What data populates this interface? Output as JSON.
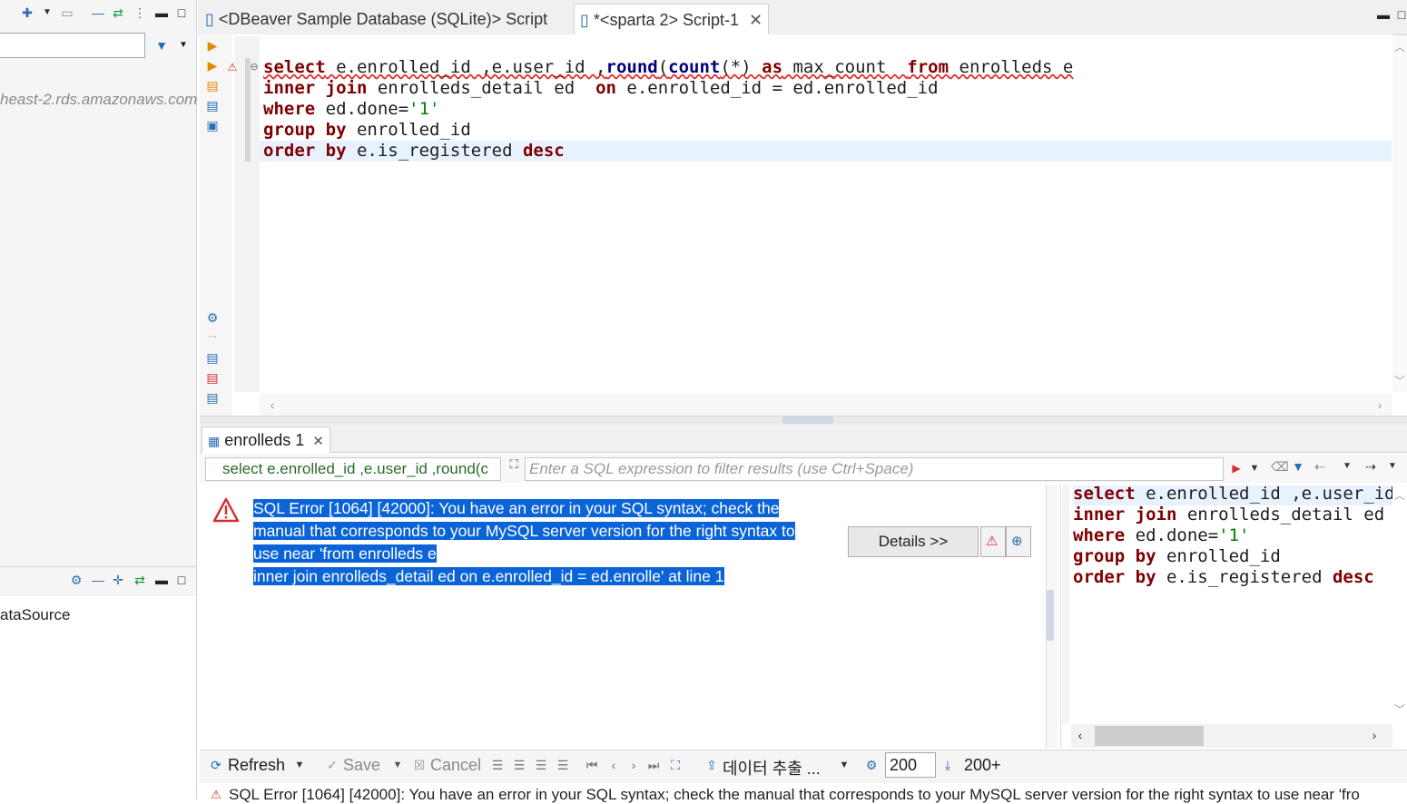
{
  "editor_tabs": [
    {
      "label": "<DBeaver Sample Database (SQLite)> Script"
    },
    {
      "label": "*<sparta 2> Script-1"
    }
  ],
  "navigator": {
    "connection_url": "heast-2.rds.amazonaws.com",
    "datasource_label": "ataSource"
  },
  "sql": {
    "lines": [
      {
        "tokens": [
          {
            "t": "select",
            "c": "kw"
          },
          {
            "t": " e.enrolled_id ,e.user_id ,",
            "c": ""
          },
          {
            "t": "round",
            "c": "kw2"
          },
          {
            "t": "(",
            "c": ""
          },
          {
            "t": "count",
            "c": "kw2"
          },
          {
            "t": "(*) ",
            "c": ""
          },
          {
            "t": "as",
            "c": "kw"
          },
          {
            "t": " max_count  ",
            "c": ""
          },
          {
            "t": "from",
            "c": "kw"
          },
          {
            "t": " enrolleds e",
            "c": ""
          }
        ]
      },
      {
        "tokens": [
          {
            "t": "inner join",
            "c": "kw"
          },
          {
            "t": " enrolleds_detail ed  ",
            "c": ""
          },
          {
            "t": "on",
            "c": "kw"
          },
          {
            "t": " e.enrolled_id = ed.enrolled_id",
            "c": ""
          }
        ]
      },
      {
        "tokens": [
          {
            "t": "where",
            "c": "kw"
          },
          {
            "t": " ed.done=",
            "c": ""
          },
          {
            "t": "'1'",
            "c": "str"
          }
        ]
      },
      {
        "tokens": [
          {
            "t": "group by",
            "c": "kw"
          },
          {
            "t": " enrolled_id",
            "c": ""
          }
        ]
      },
      {
        "tokens": [
          {
            "t": "order by",
            "c": "kw"
          },
          {
            "t": " e.is_registered ",
            "c": ""
          },
          {
            "t": "desc",
            "c": "kw"
          }
        ]
      }
    ]
  },
  "results": {
    "tab_label": "enrolleds 1",
    "query_snippet": "select e.enrolled_id ,e.user_id ,round(c",
    "filter_placeholder": "Enter a SQL expression to filter results (use Ctrl+Space)",
    "error_lines": [
      "SQL Error [1064] [42000]: You have an error in your SQL syntax; check the",
      "manual that corresponds to your MySQL server version for the right syntax to",
      "use near 'from enrolleds e",
      "inner join enrolleds_detail ed  on e.enrolled_id = ed.enrolle' at line 1"
    ],
    "details_label": "Details >>",
    "right_sql": [
      {
        "tokens": [
          {
            "t": "select",
            "c": "kw"
          },
          {
            "t": " e.enrolled_id ,e.user_id",
            "c": ""
          }
        ]
      },
      {
        "tokens": [
          {
            "t": "inner join",
            "c": "kw"
          },
          {
            "t": " enrolleds_detail ed",
            "c": ""
          }
        ]
      },
      {
        "tokens": [
          {
            "t": "where",
            "c": "kw"
          },
          {
            "t": " ed.done=",
            "c": ""
          },
          {
            "t": "'1'",
            "c": "str"
          }
        ]
      },
      {
        "tokens": [
          {
            "t": "group by",
            "c": "kw"
          },
          {
            "t": " enrolled_id",
            "c": ""
          }
        ]
      },
      {
        "tokens": [
          {
            "t": "order by",
            "c": "kw"
          },
          {
            "t": " e.is_registered ",
            "c": ""
          },
          {
            "t": "desc",
            "c": "kw"
          }
        ]
      }
    ]
  },
  "bottom_toolbar": {
    "refresh": "Refresh",
    "save": "Save",
    "cancel": "Cancel",
    "export": "데이터 추출 ...",
    "fetch_size": "200",
    "row_count": "200+"
  },
  "status": "SQL Error [1064] [42000]: You have an error in your SQL syntax; check the manual that corresponds to your MySQL server version for the right syntax to use near 'fro",
  "colors": {
    "keyword": "#7f0000",
    "function": "#000080",
    "string": "#008000",
    "selection": "#0a64d8",
    "error_icon": "#d32f2f"
  }
}
